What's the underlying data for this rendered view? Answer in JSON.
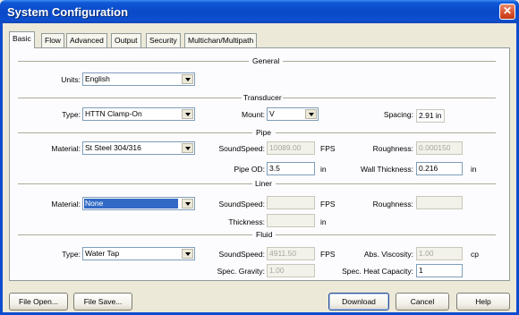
{
  "window": {
    "title": "System Configuration"
  },
  "tabs": [
    "Basic",
    "Flow",
    "Advanced",
    "Output",
    "Security",
    "Multichan/Multipath"
  ],
  "sections": {
    "general": "General",
    "transducer": "Transducer",
    "pipe": "Pipe",
    "liner": "Liner",
    "fluid": "Fluid"
  },
  "general": {
    "units_label": "Units:",
    "units_value": "English"
  },
  "transducer": {
    "type_label": "Type:",
    "type_value": "HTTN Clamp-On",
    "mount_label": "Mount:",
    "mount_value": "V",
    "spacing_label": "Spacing:",
    "spacing_value": "2.91 in"
  },
  "pipe": {
    "material_label": "Material:",
    "material_value": "St Steel 304/316",
    "soundspeed_label": "SoundSpeed:",
    "soundspeed_value": "10089.00",
    "soundspeed_unit": "FPS",
    "roughness_label": "Roughness:",
    "roughness_value": "0.000150",
    "od_label": "Pipe OD:",
    "od_value": "3.5",
    "od_unit": "in",
    "wall_label": "Wall Thickness:",
    "wall_value": "0.216",
    "wall_unit": "in"
  },
  "liner": {
    "material_label": "Material:",
    "material_value": "None",
    "soundspeed_label": "SoundSpeed:",
    "soundspeed_value": "",
    "soundspeed_unit": "FPS",
    "roughness_label": "Roughness:",
    "roughness_value": "",
    "thickness_label": "Thickness:",
    "thickness_value": "",
    "thickness_unit": "in"
  },
  "fluid": {
    "type_label": "Type:",
    "type_value": "Water Tap",
    "soundspeed_label": "SoundSpeed:",
    "soundspeed_value": "4911.50",
    "soundspeed_unit": "FPS",
    "viscosity_label": "Abs. Viscosity:",
    "viscosity_value": "1.00",
    "viscosity_unit": "cp",
    "gravity_label": "Spec. Gravity:",
    "gravity_value": "1.00",
    "heat_label": "Spec. Heat Capacity:",
    "heat_value": "1"
  },
  "buttons": {
    "file_open": "File Open...",
    "file_save": "File Save...",
    "download": "Download",
    "cancel": "Cancel",
    "help": "Help",
    "close": "✕"
  }
}
